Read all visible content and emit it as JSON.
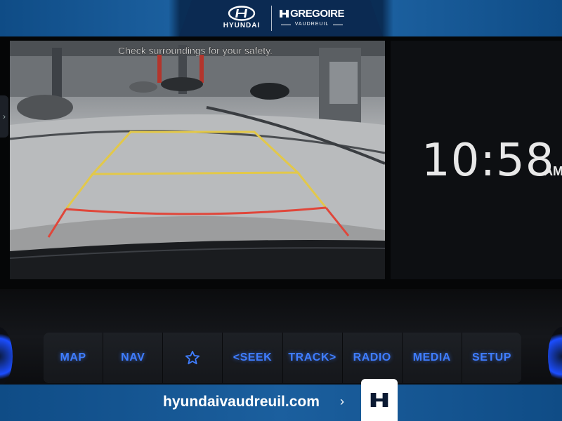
{
  "header": {
    "brand": "HYUNDAI",
    "dealer_name": "GREGOIRE",
    "dealer_location": "VAUDREUIL"
  },
  "camera": {
    "warning": "Check surroundings for your safety."
  },
  "clock": {
    "time": "10:58",
    "ampm": "AM"
  },
  "buttons": [
    {
      "label": "MAP"
    },
    {
      "label": "NAV"
    },
    {
      "label": "",
      "icon": "star-icon"
    },
    {
      "label": "<SEEK"
    },
    {
      "label": "TRACK>"
    },
    {
      "label": "RADIO"
    },
    {
      "label": "MEDIA"
    },
    {
      "label": "SETUP"
    }
  ],
  "footer": {
    "url": "hyundaivaudreuil.com",
    "arrow": "›"
  },
  "colors": {
    "button_text": "#3f7dff",
    "banner_blue": "#0f4c86",
    "guide_yellow": "#e2c84a",
    "guide_red": "#e0463a"
  }
}
